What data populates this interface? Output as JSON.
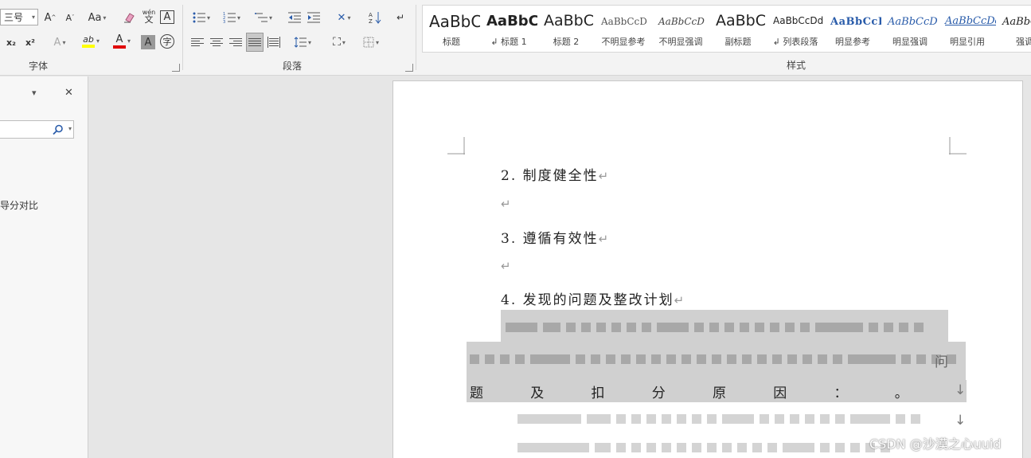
{
  "ribbon": {
    "font_group": {
      "label": "字体",
      "font_size": "三号",
      "grow_label": "A",
      "shrink_label": "A",
      "case_label": "Aa",
      "phonetic_label": "wén",
      "border_char": "A",
      "subscript_label": "x₂",
      "superscript_label": "x²",
      "effects_label": "A",
      "highlight_label": "ab",
      "font_color_label": "A",
      "shading_label": "A",
      "enclose_label": "字",
      "highlight_color": "#ffff00",
      "font_color": "#e00000"
    },
    "paragraph_group": {
      "label": "段落"
    },
    "styles_group": {
      "label": "样式",
      "items": [
        {
          "sample": "AaBbC",
          "name": "标题"
        },
        {
          "sample": "AaBbC",
          "name": "↲ 标题 1"
        },
        {
          "sample": "AaBbC",
          "name": "标题 2"
        },
        {
          "sample": "AaBbCcD",
          "name": "不明显参考"
        },
        {
          "sample": "AaBbCcD",
          "name": "不明显强调"
        },
        {
          "sample": "AaBbC",
          "name": "副标题"
        },
        {
          "sample": "AaBbCcDd",
          "name": "↲ 列表段落"
        },
        {
          "sample": "AaBbCcI",
          "name": "明显参考"
        },
        {
          "sample": "AaBbCcD",
          "name": "明显强调"
        },
        {
          "sample": "AaBbCcDd",
          "name": "明显引用"
        },
        {
          "sample": "AaBbC",
          "name": "强调"
        }
      ]
    }
  },
  "nav_pane": {
    "dropdown_icon": "▾",
    "close_icon": "✕",
    "search_icon": "⌕",
    "item_text": "导分对比"
  },
  "document": {
    "p1": "2. 制度健全性",
    "p2": "3. 遵循有效性",
    "p3": "4. 发现的问题及整改计划",
    "para_mark": "↵",
    "line_break_mark": "↓",
    "justified_tail_chars": [
      "题",
      "及",
      "扣",
      "分",
      "原",
      "因",
      "：",
      "。"
    ],
    "tail_char": "问"
  },
  "watermark": "CSDN @沙漠之心uuid"
}
